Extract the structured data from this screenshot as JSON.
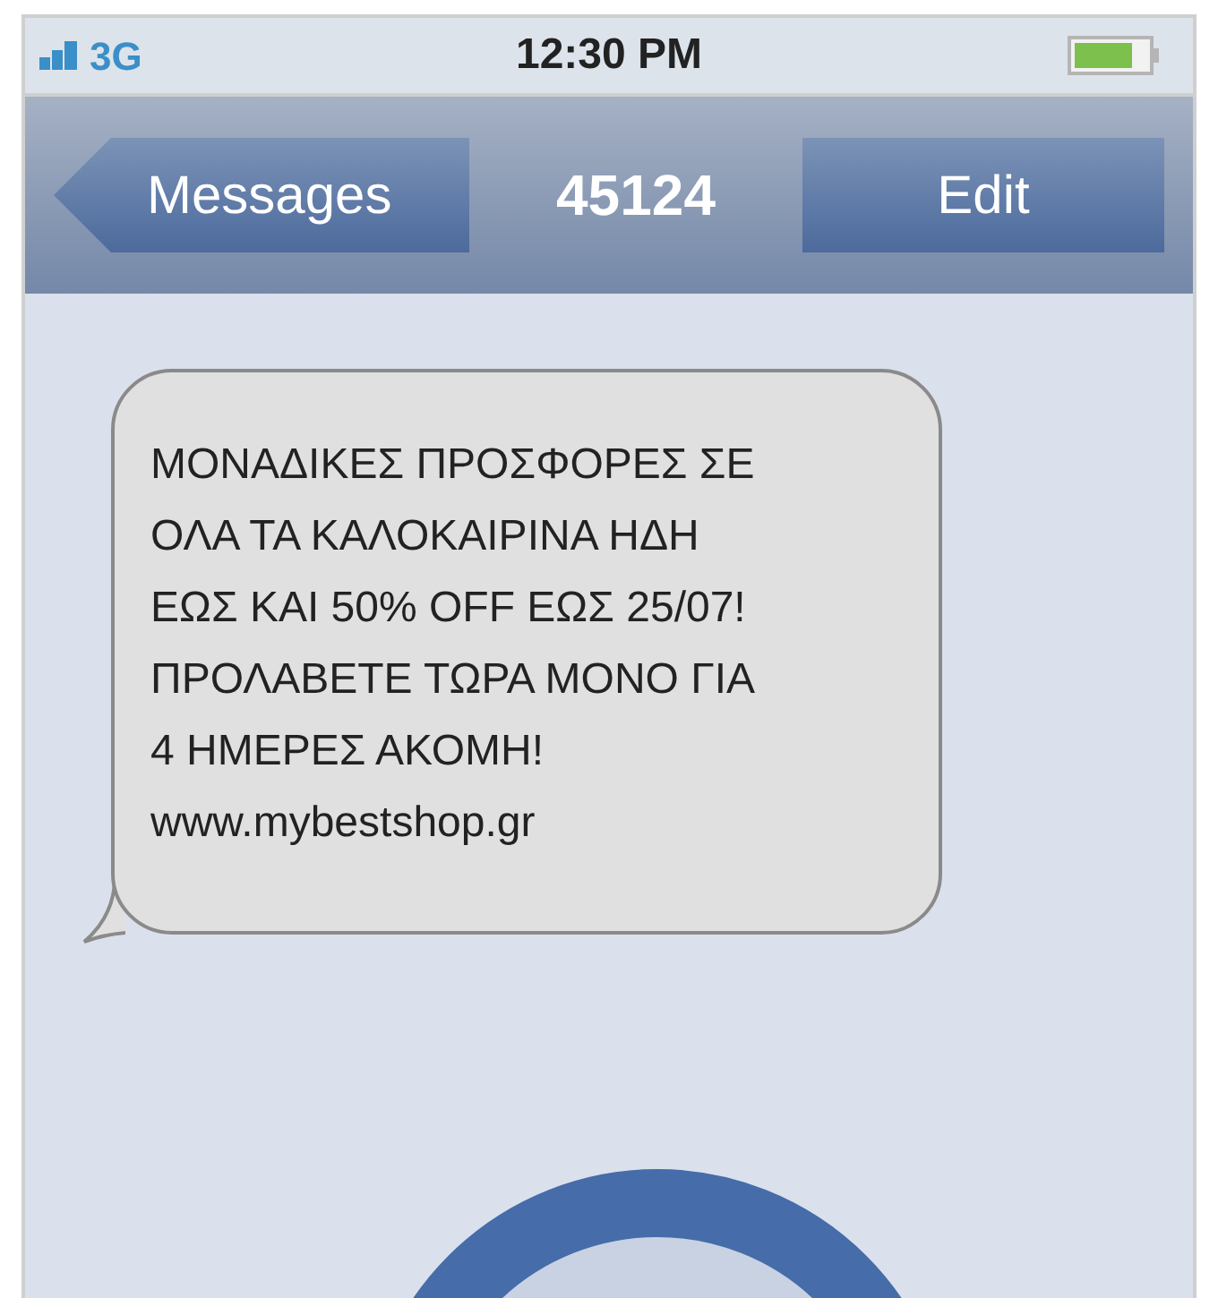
{
  "status_bar": {
    "network": "3G",
    "time": "12:30 PM"
  },
  "nav_bar": {
    "back": "Messages",
    "title": "45124",
    "action": "Edit"
  },
  "messages": [
    {
      "text": "ΜΟΝΑΔΙΚΕΣ ΠΡΟΣΦΟΡΕΣ ΣΕ\nΟΛΑ ΤΑ ΚΑΛΟΚΑΙΡΙΝΑ ΗΔΗ\nΕΩΣ ΚΑΙ 50% OFF ΕΩΣ 25/07!\nΠΡΟΛΑΒΕΤΕ ΤΩΡΑ ΜΟΝΟ ΓΙΑ\n4 ΗΜΕΡΕΣ ΑΚΟΜΗ!\nwww.mybestshop.gr"
    }
  ]
}
